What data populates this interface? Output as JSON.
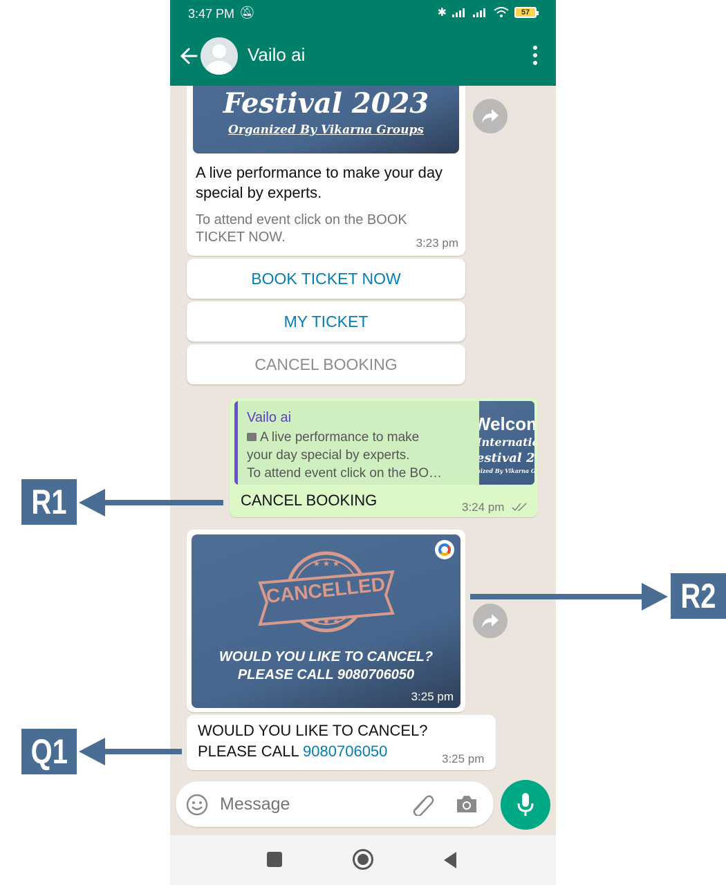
{
  "status_bar": {
    "time": "3:47 PM",
    "icons_left": [
      "mute-icon",
      "alarm-icon",
      "sync-icon"
    ],
    "battery": "57"
  },
  "header": {
    "contact_name": "Vailo ai"
  },
  "messages": {
    "event_card": {
      "banner_title": "Festival 2023",
      "banner_subtitle": "Organized By Vikarna Groups",
      "body": "A live performance  to make your day special by experts.",
      "footer": "To attend event  click on the BOOK TICKET NOW.",
      "time": "3:23 pm",
      "buttons": [
        "BOOK TICKET NOW",
        "MY TICKET",
        "CANCEL BOOKING"
      ]
    },
    "reply": {
      "quoted_sender": "Vailo ai",
      "quoted_line1": "A live performance  to make",
      "quoted_line2": "your day special by experts.",
      "quoted_line3": "To attend event  click on the BO…",
      "thumb_line1": "Welcom",
      "thumb_line2": "Internatio",
      "thumb_line3": "estival 20",
      "thumb_line4": "nized By Vikarna G",
      "text": "CANCEL BOOKING",
      "time": "3:24 pm"
    },
    "cancel_image": {
      "stamp_text": "CANCELLED",
      "caption_line1": "WOULD YOU LIKE TO CANCEL?",
      "caption_line2": "PLEASE CALL 9080706050",
      "time": "3:25 pm"
    },
    "cancel_text": {
      "line1": "WOULD YOU LIKE TO CANCEL?",
      "line2_prefix": "PLEASE CALL ",
      "phone": "9080706050",
      "time": "3:25 pm"
    }
  },
  "input": {
    "placeholder": "Message"
  },
  "annotations": {
    "r1": "R1",
    "r2": "R2",
    "q1": "Q1"
  },
  "colors": {
    "header": "#008069",
    "chat_bg": "#ece5dd",
    "outgoing": "#dcf8c6",
    "button_text": "#027eb5",
    "annotation": "#4a6d94",
    "link": "#027eb5"
  }
}
